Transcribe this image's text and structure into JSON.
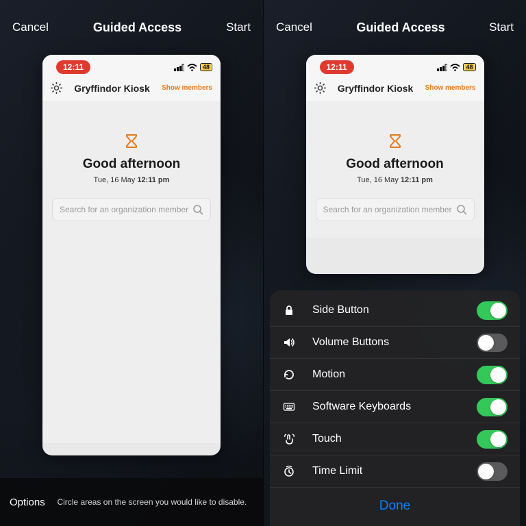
{
  "top": {
    "cancel": "Cancel",
    "title": "Guided Access",
    "start": "Start"
  },
  "status": {
    "time": "12:11",
    "battery": "48"
  },
  "app": {
    "title": "Gryffindor Kiosk",
    "show_members": "Show members"
  },
  "main": {
    "greeting": "Good afternoon",
    "date_prefix": "Tue, 16 May ",
    "date_time": "12:11 pm",
    "search_placeholder": "Search for an organization member"
  },
  "left_footer": {
    "options": "Options",
    "hint": "Circle areas on the screen you would like to disable."
  },
  "sheet": {
    "rows": [
      {
        "label": "Side Button",
        "on": true
      },
      {
        "label": "Volume Buttons",
        "on": false
      },
      {
        "label": "Motion",
        "on": true
      },
      {
        "label": "Software Keyboards",
        "on": true
      },
      {
        "label": "Touch",
        "on": true
      },
      {
        "label": "Time Limit",
        "on": false
      }
    ],
    "done": "Done"
  }
}
